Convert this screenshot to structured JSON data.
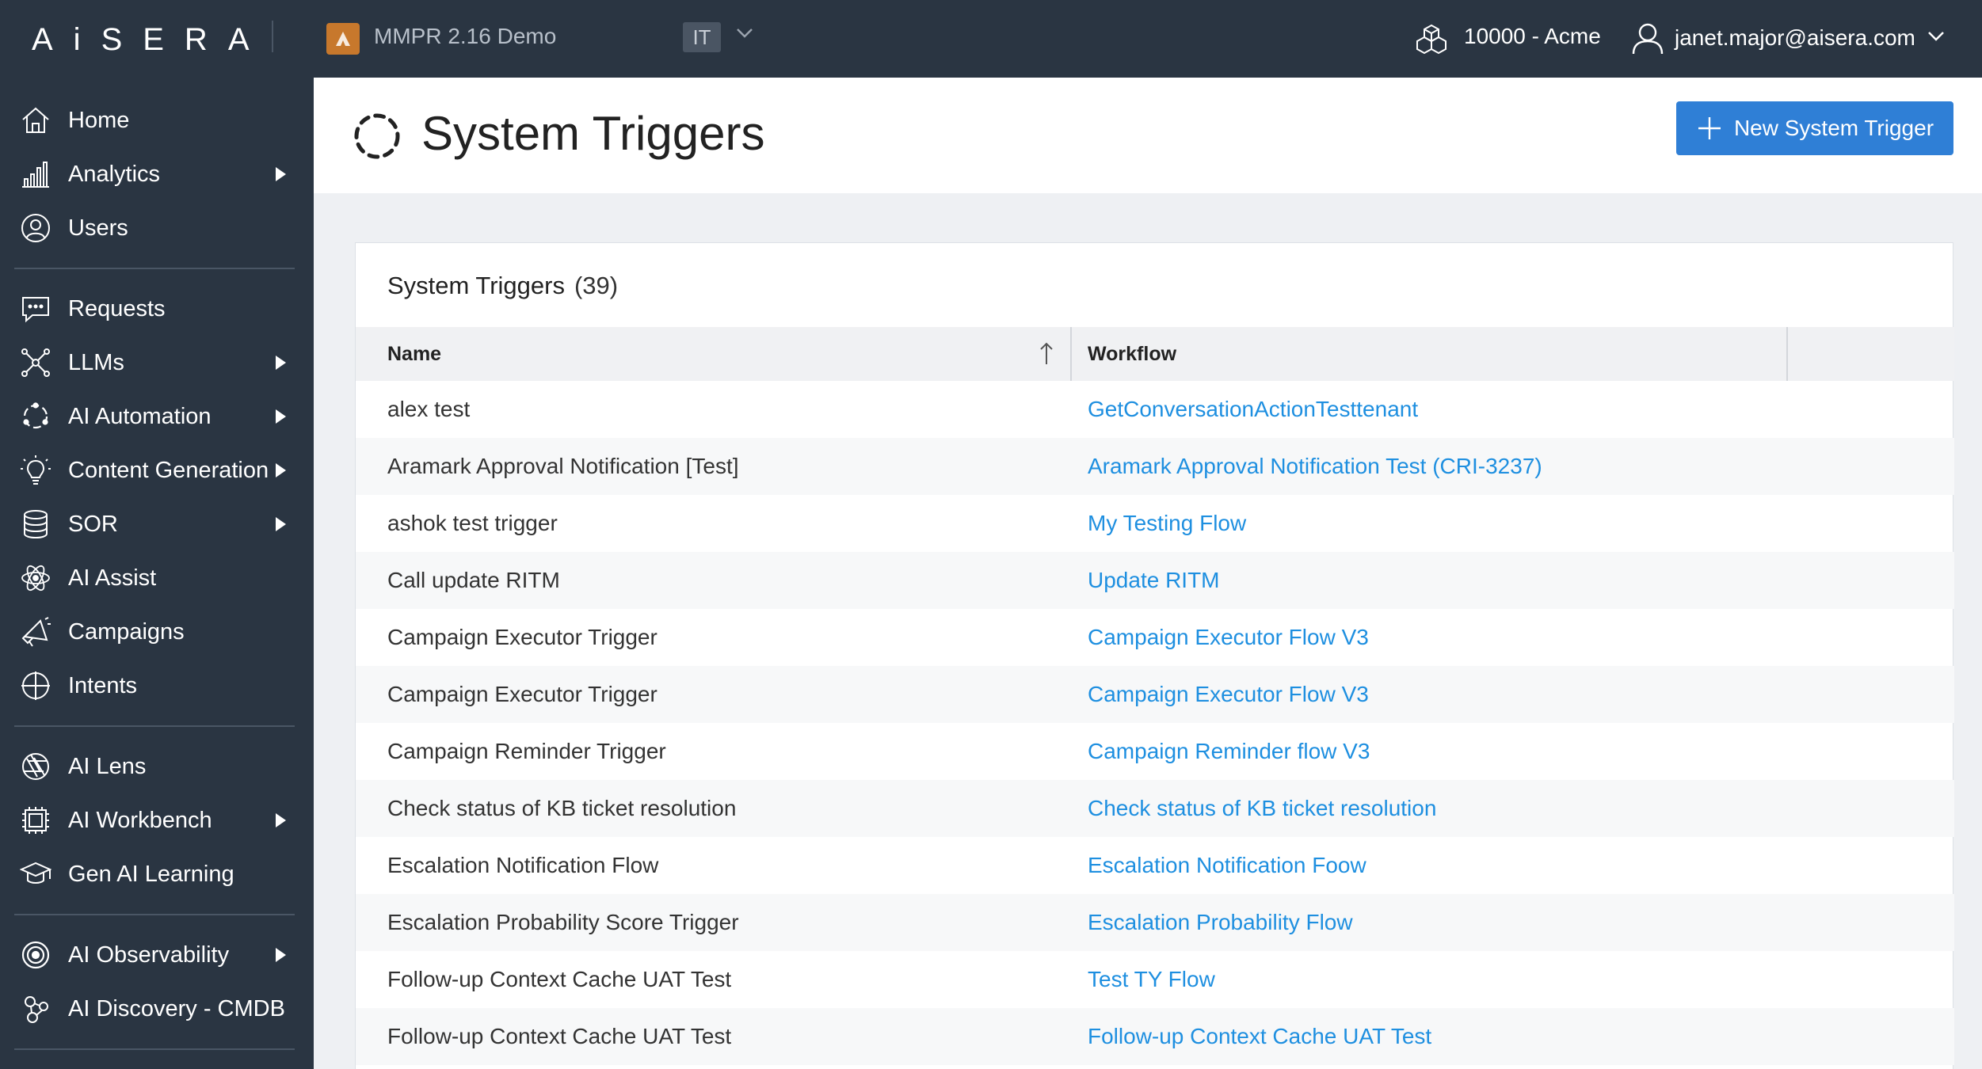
{
  "topbar": {
    "logo": "AiSERA",
    "tenant_name": "MMPR 2.16 Demo",
    "domain_badge": "IT",
    "org": "10000 - Acme",
    "user_email": "janet.major@aisera.com"
  },
  "sidebar": {
    "items": [
      {
        "label": "Home",
        "icon": "home-icon",
        "has_submenu": false
      },
      {
        "label": "Analytics",
        "icon": "bar-chart-icon",
        "has_submenu": true
      },
      {
        "label": "Users",
        "icon": "user-circle-icon",
        "has_submenu": false
      },
      {
        "label": "Requests",
        "icon": "chat-icon",
        "has_submenu": false
      },
      {
        "label": "LLMs",
        "icon": "network-icon",
        "has_submenu": true
      },
      {
        "label": "AI Automation",
        "icon": "cycle-icon",
        "has_submenu": true
      },
      {
        "label": "Content Generation",
        "icon": "bulb-icon",
        "has_submenu": true
      },
      {
        "label": "SOR",
        "icon": "database-icon",
        "has_submenu": true
      },
      {
        "label": "AI Assist",
        "icon": "atom-icon",
        "has_submenu": false
      },
      {
        "label": "Campaigns",
        "icon": "megaphone-icon",
        "has_submenu": false
      },
      {
        "label": "Intents",
        "icon": "crosshair-icon",
        "has_submenu": false
      },
      {
        "label": "AI Lens",
        "icon": "aperture-icon",
        "has_submenu": false
      },
      {
        "label": "AI Workbench",
        "icon": "chip-icon",
        "has_submenu": true
      },
      {
        "label": "Gen AI Learning",
        "icon": "graduation-cap-icon",
        "has_submenu": false
      },
      {
        "label": "AI Observability",
        "icon": "target-icon",
        "has_submenu": true
      },
      {
        "label": "AI Discovery - CMDB",
        "icon": "nodes-icon",
        "has_submenu": false
      }
    ]
  },
  "header": {
    "title": "System Triggers",
    "new_button": "New System Trigger"
  },
  "card": {
    "title": "System Triggers",
    "count": "(39)"
  },
  "table": {
    "columns": [
      "Name",
      "Workflow"
    ],
    "rows": [
      {
        "name": "alex test",
        "workflow": "GetConversationActionTesttenant"
      },
      {
        "name": "Aramark Approval Notification [Test]",
        "workflow": "Aramark Approval Notification Test (CRI-3237)"
      },
      {
        "name": "ashok test trigger",
        "workflow": "My Testing Flow"
      },
      {
        "name": "Call update RITM",
        "workflow": "Update RITM"
      },
      {
        "name": "Campaign Executor Trigger",
        "workflow": "Campaign Executor Flow V3"
      },
      {
        "name": "Campaign Executor Trigger",
        "workflow": "Campaign Executor Flow V3"
      },
      {
        "name": "Campaign Reminder Trigger",
        "workflow": "Campaign Reminder flow V3"
      },
      {
        "name": "Check status of KB ticket resolution",
        "workflow": "Check status of KB ticket resolution"
      },
      {
        "name": "Escalation Notification Flow",
        "workflow": "Escalation Notification Foow"
      },
      {
        "name": "Escalation Probability Score Trigger",
        "workflow": "Escalation Probability Flow"
      },
      {
        "name": "Follow-up Context Cache UAT Test",
        "workflow": "Test TY Flow"
      },
      {
        "name": "Follow-up Context Cache UAT Test",
        "workflow": "Follow-up Context Cache UAT Test"
      }
    ]
  },
  "colors": {
    "topbar_bg": "#2a3542",
    "accent_blue": "#2f7fd6",
    "link_blue": "#1e8fe0",
    "tenant_orange": "#c7782c"
  }
}
